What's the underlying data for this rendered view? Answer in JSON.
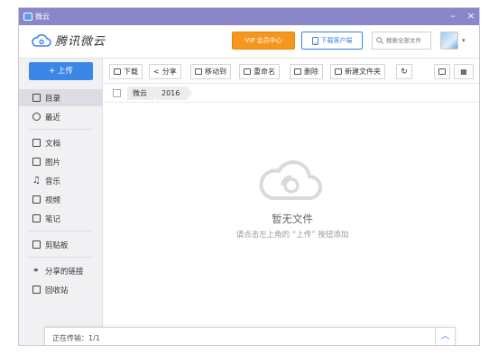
{
  "titlebar": {
    "title": "微云",
    "minimize": "–",
    "close": "×"
  },
  "header": {
    "logo_text": "腾讯微云",
    "vip_label": "VIP 会员中心",
    "download_client_label": "下载客户端",
    "search_placeholder": "搜索全部文件"
  },
  "sidebar": {
    "upload_label": "+ 上传",
    "items": [
      {
        "label": "目录",
        "icon": "folder-list-icon"
      },
      {
        "label": "最近",
        "icon": "clock-icon"
      },
      {
        "label": "文档",
        "icon": "document-icon"
      },
      {
        "label": "图片",
        "icon": "image-icon"
      },
      {
        "label": "音乐",
        "icon": "music-icon"
      },
      {
        "label": "视频",
        "icon": "video-icon"
      },
      {
        "label": "笔记",
        "icon": "note-icon"
      },
      {
        "label": "剪贴板",
        "icon": "clipboard-icon"
      },
      {
        "label": "分享的链接",
        "icon": "link-icon"
      },
      {
        "label": "回收站",
        "icon": "trash-icon"
      }
    ]
  },
  "toolbar": {
    "download": "下载",
    "share": "分享",
    "move_to": "移动到",
    "rename": "重命名",
    "delete": "删除",
    "new_folder": "新建文件夹"
  },
  "breadcrumb": {
    "root": "微云",
    "current": "2016"
  },
  "empty": {
    "title": "暂无文件",
    "hint": "请点击左上角的 “上传” 按钮添加"
  },
  "status": {
    "text": "正在传输：1/1"
  },
  "colors": {
    "titlebar": "#8b86c9",
    "accent": "#3b87e8",
    "vip": "#f7961f"
  }
}
